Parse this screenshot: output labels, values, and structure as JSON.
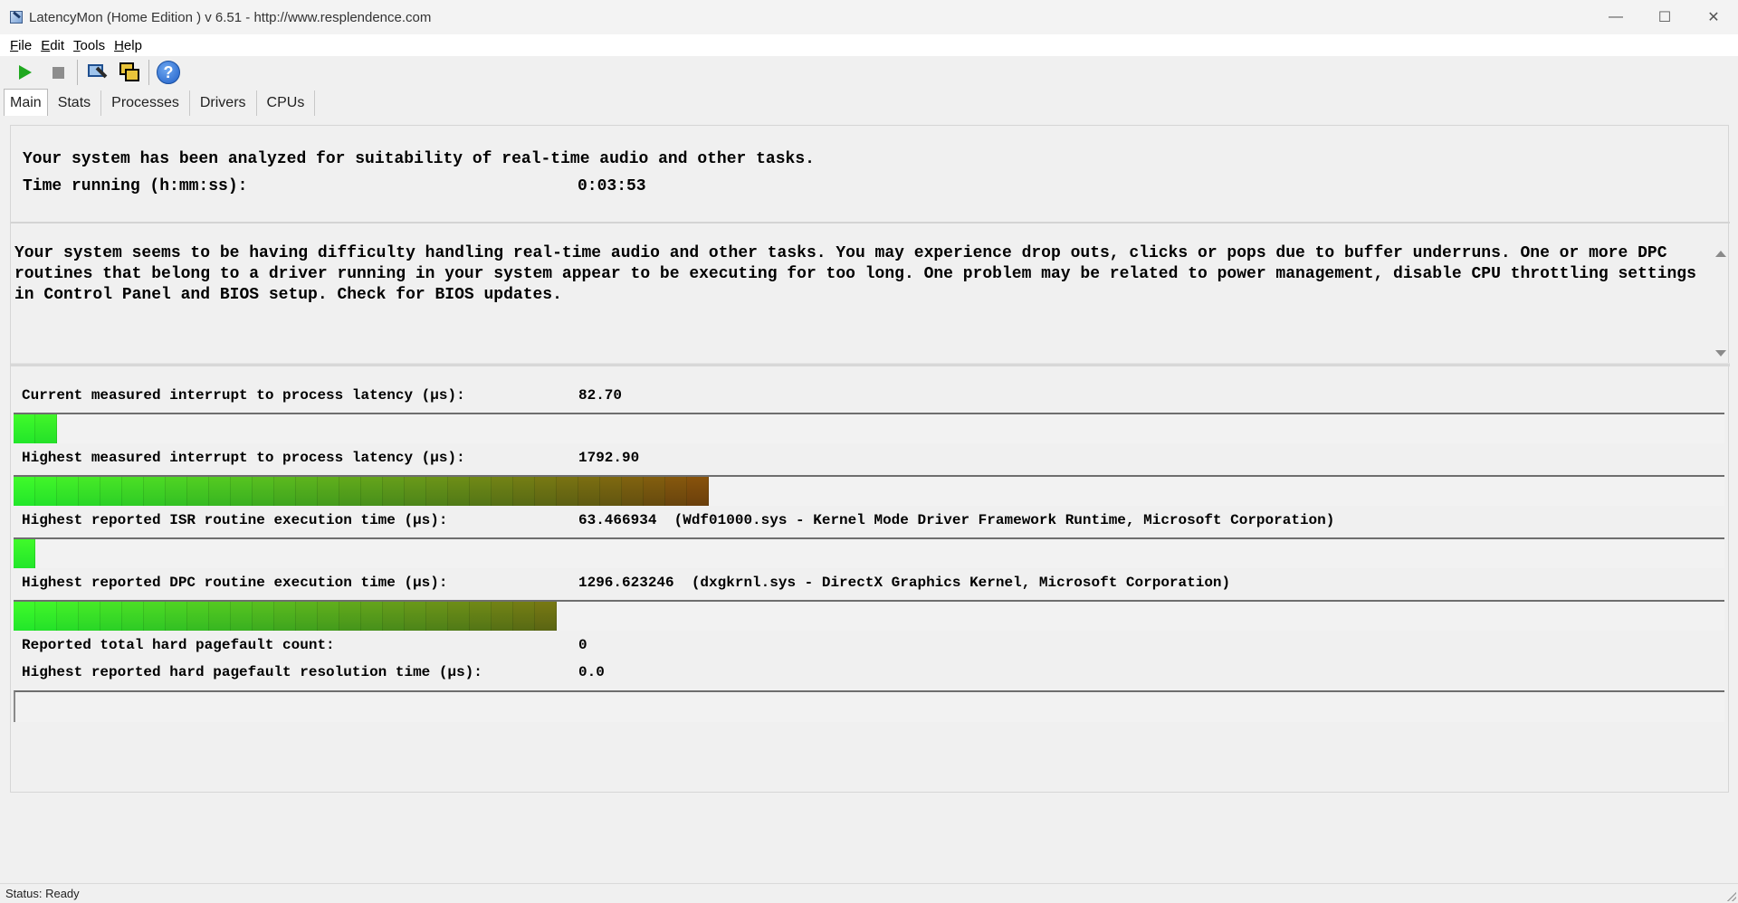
{
  "window": {
    "title": "LatencyMon  (Home Edition )  v 6.51 - http://www.resplendence.com",
    "minimize_glyph": "—",
    "maximize_glyph": "☐",
    "close_glyph": "✕"
  },
  "menu": {
    "file": {
      "u": "F",
      "rest": "ile"
    },
    "edit": {
      "u": "E",
      "rest": "dit"
    },
    "tools": {
      "u": "T",
      "rest": "ools"
    },
    "help": {
      "u": "H",
      "rest": "elp"
    }
  },
  "toolbar": {
    "icons": [
      "play-icon",
      "stop-icon",
      "configure-icon",
      "cpu-windows-icon",
      "help-icon"
    ],
    "help_glyph": "?"
  },
  "tabs": [
    {
      "label": "Main",
      "active": true
    },
    {
      "label": "Stats",
      "active": false
    },
    {
      "label": "Processes",
      "active": false
    },
    {
      "label": "Drivers",
      "active": false
    },
    {
      "label": "CPUs",
      "active": false
    }
  ],
  "summary": {
    "line1": "Your system has been analyzed for suitability of real-time audio and other tasks.",
    "time_label": "Time running (h:mm:ss):",
    "time_value": "0:03:53"
  },
  "verdict": "Your system seems to be having difficulty handling real-time audio and other tasks. You may experience drop outs, clicks or pops due to buffer underruns. One or more DPC routines that belong to a driver running in your system appear to be executing for too long. One problem may be related to power management, disable CPU throttling settings in Control Panel and BIOS setup. Check for BIOS updates.",
  "metrics": {
    "current_latency": {
      "label": "Current measured interrupt to process latency (µs):",
      "value": "82.70",
      "bar_segments": 2
    },
    "highest_latency": {
      "label": "Highest measured interrupt to process latency (µs):",
      "value": "1792.90",
      "bar_segments": 32
    },
    "isr": {
      "label": "Highest reported ISR routine execution time (µs):",
      "value": "63.466934",
      "detail": "(Wdf01000.sys - Kernel Mode Driver Framework Runtime, Microsoft Corporation)",
      "bar_segments": 1
    },
    "dpc": {
      "label": "Highest reported DPC routine execution time (µs):",
      "value": "1296.623246",
      "detail": "(dxgkrnl.sys - DirectX Graphics Kernel, Microsoft Corporation)",
      "bar_segments": 25
    },
    "pagefault_count": {
      "label": "Reported total hard pagefault count:",
      "value": "0"
    },
    "pagefault_time": {
      "label": "Highest reported hard pagefault resolution time (µs):",
      "value": "0.0"
    }
  },
  "colors": {
    "bar_start": "#22e62a",
    "bar_end": "#6a3f0c"
  },
  "status": "Status: Ready"
}
